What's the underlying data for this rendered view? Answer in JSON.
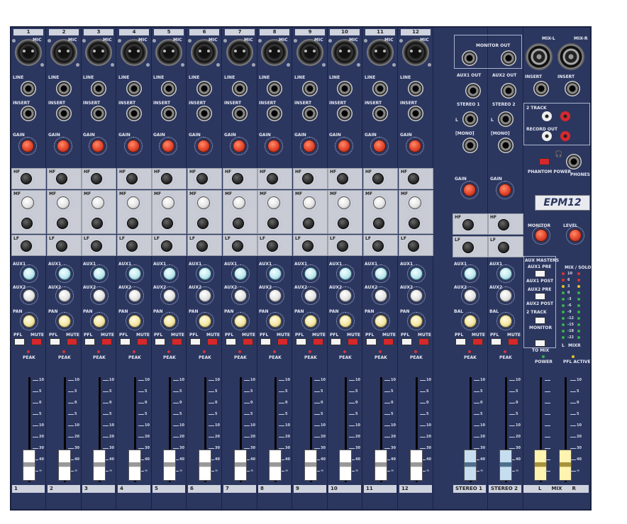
{
  "mixer": {
    "brand_logo": "EPM12",
    "channels": [
      "1",
      "2",
      "3",
      "4",
      "5",
      "6",
      "7",
      "8",
      "9",
      "10",
      "11",
      "12"
    ],
    "channel_labels": {
      "mic": "MIC",
      "line": "LINE",
      "insert": "INSERT",
      "gain": "GAIN",
      "hf": "HF",
      "mf": "MF",
      "lf": "LF",
      "aux1": "AUX1",
      "aux2": "AUX2",
      "pan": "PAN",
      "pfl": "PFL",
      "mute": "MUTE",
      "peak": "PEAK"
    },
    "stereo_labels": {
      "stereo1": "STEREO 1",
      "stereo2": "STEREO 2",
      "mono": "[MONO]",
      "bal": "BAL",
      "gain": "GAIN"
    },
    "master_labels": {
      "monitor_out": "MONITOR OUT",
      "aux1_out": "AUX1 OUT",
      "aux2_out": "AUX2 OUT",
      "mix_l": "MIX-L",
      "mix_r": "MIX-R",
      "insert": "INSERT",
      "two_track": "2 TRACK",
      "record_out": "RECORD OUT",
      "phantom": "PHANTOM POWER",
      "phones": "PHONES",
      "monitor": "MONITOR",
      "level": "LEVEL",
      "aux_masters": "AUX MASTERS",
      "aux1_pre": "AUX1 PRE",
      "aux1_post": "AUX1 POST",
      "aux2_pre": "AUX2 PRE",
      "aux2_post": "AUX2 POST",
      "two_track_section": "2 TRACK",
      "to_monitor": "MONITOR",
      "to_mix": "TO MIX",
      "mix_solo": "MIX / SOLO",
      "power": "POWER",
      "pfl_active": "PFL ACTIVE",
      "l": "L",
      "r": "R",
      "mix": "MIX"
    },
    "meter_scale": [
      "10",
      "6",
      "3",
      "0",
      "-3",
      "-6",
      "-9",
      "-12",
      "-15",
      "-18",
      "-22"
    ],
    "fader_scale": [
      "10",
      "5",
      "0",
      "5",
      "10",
      "20",
      "30",
      "40",
      "∞"
    ],
    "bottom_labels": [
      "1",
      "2",
      "3",
      "4",
      "5",
      "6",
      "7",
      "8",
      "9",
      "10",
      "11",
      "12",
      "STEREO 1",
      "STEREO 2",
      "L",
      "MIX",
      "R"
    ],
    "colors": {
      "panel": "#2c3760",
      "gain_knob": "#e2442a",
      "aux_knob": "#bfe8ef",
      "pan_knob": "#f3e6a5",
      "mute": "#d5272c"
    }
  }
}
